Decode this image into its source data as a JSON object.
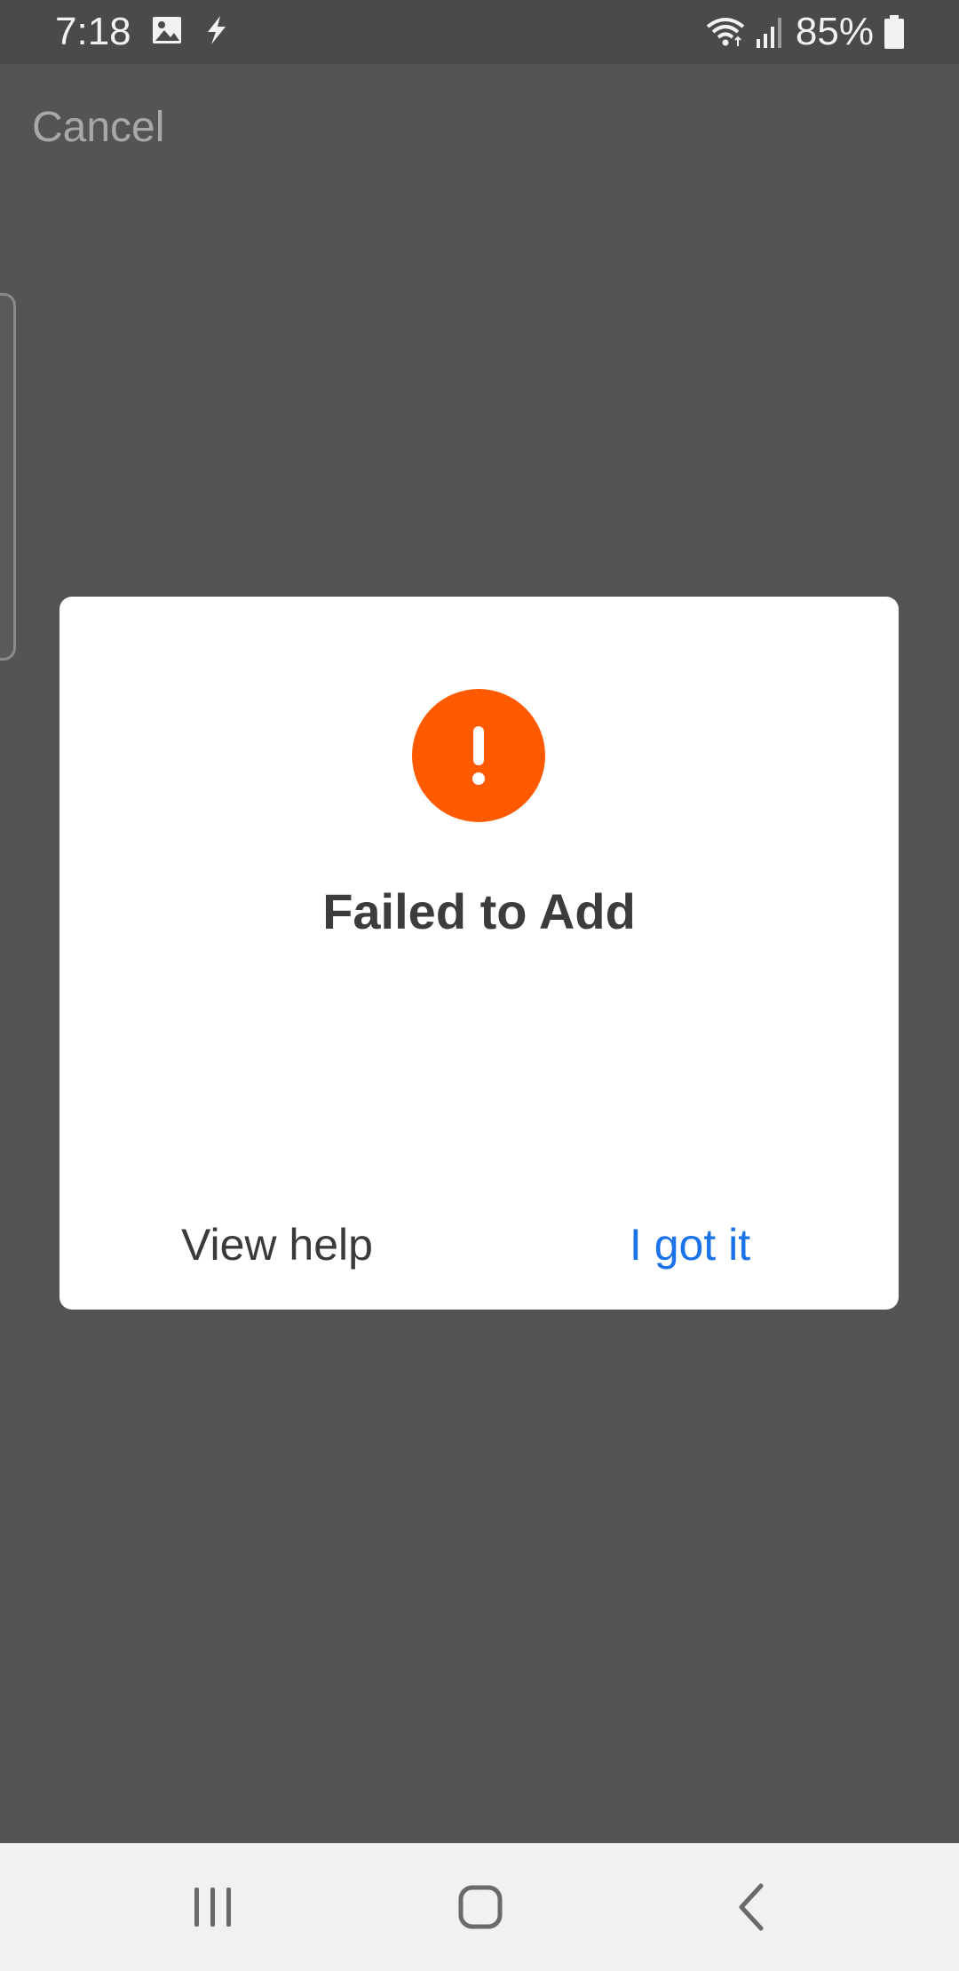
{
  "status_bar": {
    "time": "7:18",
    "battery_text": "85%",
    "icons": [
      "image-icon",
      "flash-icon",
      "wifi-icon",
      "signal-icon",
      "battery-icon"
    ]
  },
  "header": {
    "cancel_label": "Cancel"
  },
  "dialog": {
    "icon": "alert-icon",
    "icon_color": "#ff5a00",
    "title": "Failed to Add",
    "help_label": "View help",
    "confirm_label": "I got it",
    "confirm_color": "#1a73e8"
  },
  "nav_bar": {
    "icons": [
      "recent-apps-icon",
      "home-icon",
      "back-icon"
    ]
  }
}
